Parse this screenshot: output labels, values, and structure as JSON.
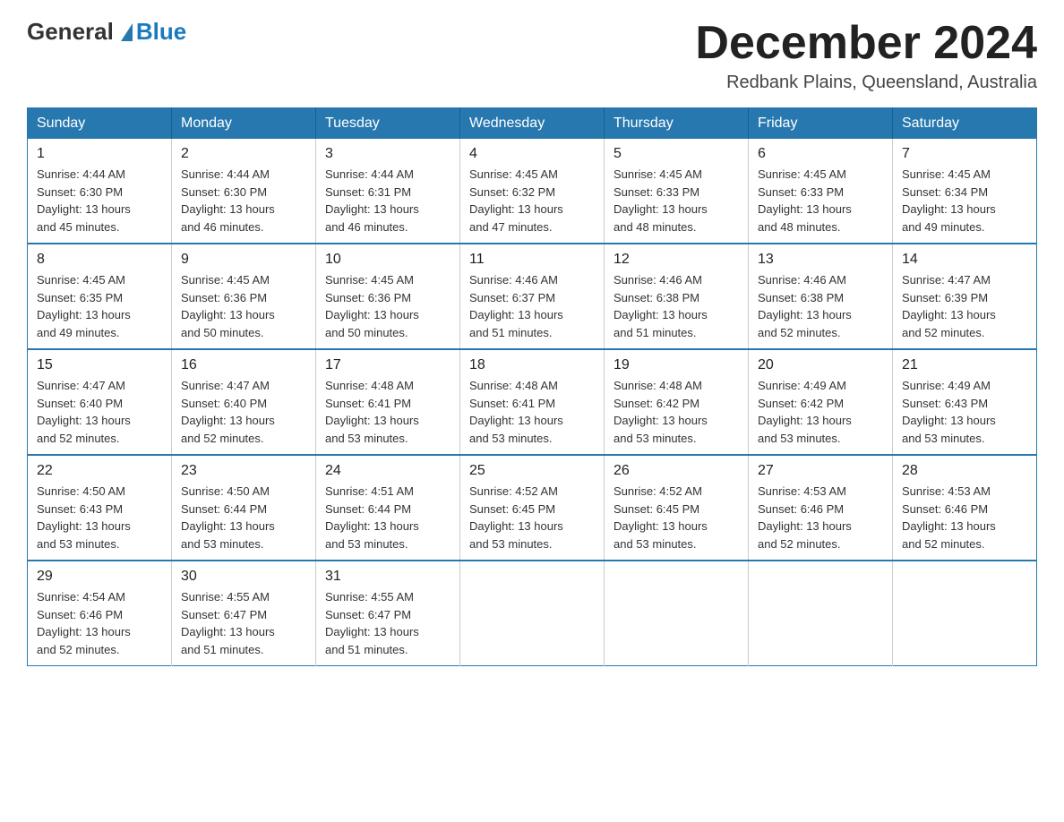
{
  "logo": {
    "general": "General",
    "blue": "Blue"
  },
  "title": "December 2024",
  "location": "Redbank Plains, Queensland, Australia",
  "weekdays": [
    "Sunday",
    "Monday",
    "Tuesday",
    "Wednesday",
    "Thursday",
    "Friday",
    "Saturday"
  ],
  "weeks": [
    [
      {
        "day": "1",
        "sunrise": "4:44 AM",
        "sunset": "6:30 PM",
        "daylight": "13 hours and 45 minutes."
      },
      {
        "day": "2",
        "sunrise": "4:44 AM",
        "sunset": "6:30 PM",
        "daylight": "13 hours and 46 minutes."
      },
      {
        "day": "3",
        "sunrise": "4:44 AM",
        "sunset": "6:31 PM",
        "daylight": "13 hours and 46 minutes."
      },
      {
        "day": "4",
        "sunrise": "4:45 AM",
        "sunset": "6:32 PM",
        "daylight": "13 hours and 47 minutes."
      },
      {
        "day": "5",
        "sunrise": "4:45 AM",
        "sunset": "6:33 PM",
        "daylight": "13 hours and 48 minutes."
      },
      {
        "day": "6",
        "sunrise": "4:45 AM",
        "sunset": "6:33 PM",
        "daylight": "13 hours and 48 minutes."
      },
      {
        "day": "7",
        "sunrise": "4:45 AM",
        "sunset": "6:34 PM",
        "daylight": "13 hours and 49 minutes."
      }
    ],
    [
      {
        "day": "8",
        "sunrise": "4:45 AM",
        "sunset": "6:35 PM",
        "daylight": "13 hours and 49 minutes."
      },
      {
        "day": "9",
        "sunrise": "4:45 AM",
        "sunset": "6:36 PM",
        "daylight": "13 hours and 50 minutes."
      },
      {
        "day": "10",
        "sunrise": "4:45 AM",
        "sunset": "6:36 PM",
        "daylight": "13 hours and 50 minutes."
      },
      {
        "day": "11",
        "sunrise": "4:46 AM",
        "sunset": "6:37 PM",
        "daylight": "13 hours and 51 minutes."
      },
      {
        "day": "12",
        "sunrise": "4:46 AM",
        "sunset": "6:38 PM",
        "daylight": "13 hours and 51 minutes."
      },
      {
        "day": "13",
        "sunrise": "4:46 AM",
        "sunset": "6:38 PM",
        "daylight": "13 hours and 52 minutes."
      },
      {
        "day": "14",
        "sunrise": "4:47 AM",
        "sunset": "6:39 PM",
        "daylight": "13 hours and 52 minutes."
      }
    ],
    [
      {
        "day": "15",
        "sunrise": "4:47 AM",
        "sunset": "6:40 PM",
        "daylight": "13 hours and 52 minutes."
      },
      {
        "day": "16",
        "sunrise": "4:47 AM",
        "sunset": "6:40 PM",
        "daylight": "13 hours and 52 minutes."
      },
      {
        "day": "17",
        "sunrise": "4:48 AM",
        "sunset": "6:41 PM",
        "daylight": "13 hours and 53 minutes."
      },
      {
        "day": "18",
        "sunrise": "4:48 AM",
        "sunset": "6:41 PM",
        "daylight": "13 hours and 53 minutes."
      },
      {
        "day": "19",
        "sunrise": "4:48 AM",
        "sunset": "6:42 PM",
        "daylight": "13 hours and 53 minutes."
      },
      {
        "day": "20",
        "sunrise": "4:49 AM",
        "sunset": "6:42 PM",
        "daylight": "13 hours and 53 minutes."
      },
      {
        "day": "21",
        "sunrise": "4:49 AM",
        "sunset": "6:43 PM",
        "daylight": "13 hours and 53 minutes."
      }
    ],
    [
      {
        "day": "22",
        "sunrise": "4:50 AM",
        "sunset": "6:43 PM",
        "daylight": "13 hours and 53 minutes."
      },
      {
        "day": "23",
        "sunrise": "4:50 AM",
        "sunset": "6:44 PM",
        "daylight": "13 hours and 53 minutes."
      },
      {
        "day": "24",
        "sunrise": "4:51 AM",
        "sunset": "6:44 PM",
        "daylight": "13 hours and 53 minutes."
      },
      {
        "day": "25",
        "sunrise": "4:52 AM",
        "sunset": "6:45 PM",
        "daylight": "13 hours and 53 minutes."
      },
      {
        "day": "26",
        "sunrise": "4:52 AM",
        "sunset": "6:45 PM",
        "daylight": "13 hours and 53 minutes."
      },
      {
        "day": "27",
        "sunrise": "4:53 AM",
        "sunset": "6:46 PM",
        "daylight": "13 hours and 52 minutes."
      },
      {
        "day": "28",
        "sunrise": "4:53 AM",
        "sunset": "6:46 PM",
        "daylight": "13 hours and 52 minutes."
      }
    ],
    [
      {
        "day": "29",
        "sunrise": "4:54 AM",
        "sunset": "6:46 PM",
        "daylight": "13 hours and 52 minutes."
      },
      {
        "day": "30",
        "sunrise": "4:55 AM",
        "sunset": "6:47 PM",
        "daylight": "13 hours and 51 minutes."
      },
      {
        "day": "31",
        "sunrise": "4:55 AM",
        "sunset": "6:47 PM",
        "daylight": "13 hours and 51 minutes."
      },
      null,
      null,
      null,
      null
    ]
  ]
}
